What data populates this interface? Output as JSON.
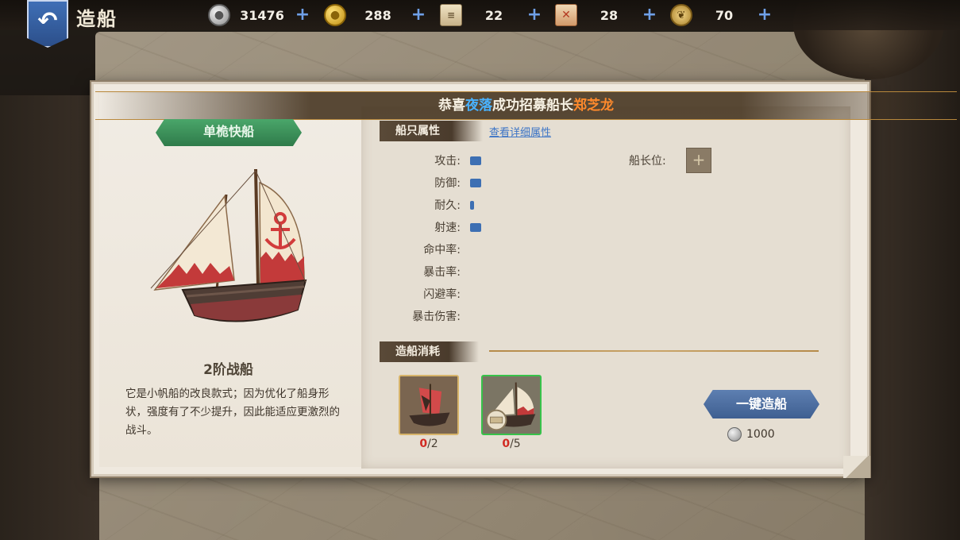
{
  "header": {
    "back_icon": "back-arrow-icon",
    "title": "造船"
  },
  "resources": [
    {
      "icon": "silver-coin-icon",
      "value": "31476",
      "color": "#cfcfcf"
    },
    {
      "icon": "gold-coin-icon",
      "value": "288",
      "color": "#e6b21c"
    },
    {
      "icon": "scroll-icon",
      "value": "22",
      "color": "#d9c59a"
    },
    {
      "icon": "map-ticket-icon",
      "value": "28",
      "color": "#d08a5a"
    },
    {
      "icon": "laurel-medal-icon",
      "value": "70",
      "color": "#c9a54e"
    }
  ],
  "banner": {
    "prefix": "恭喜",
    "player": "夜落",
    "middle": "成功招募船长",
    "captain": "郑芝龙"
  },
  "ship": {
    "type_tab": "单桅快船",
    "name": "2阶战船",
    "description": "它是小帆船的改良款式；因为优化了船身形状，强度有了不少提升，因此能适应更激烈的战斗。"
  },
  "attributes": {
    "header": "船只属性",
    "detail_link": "查看详细属性",
    "stats": [
      {
        "label": "攻击:",
        "level": 0.35
      },
      {
        "label": "防御:",
        "level": 0.35
      },
      {
        "label": "耐久:",
        "level": 0.12
      },
      {
        "label": "射速:",
        "level": 0.35
      },
      {
        "label": "命中率:",
        "level": 0
      },
      {
        "label": "暴击率:",
        "level": 0
      },
      {
        "label": "闪避率:",
        "level": 0
      },
      {
        "label": "暴击伤害:",
        "level": 0
      }
    ],
    "captain_label": "船长位:",
    "captain_slot": "+"
  },
  "cost_section": {
    "header": "造船消耗",
    "materials": [
      {
        "icon": "damaged-ship-icon",
        "have": "0",
        "need": "/2",
        "border": "#d7b46a"
      },
      {
        "icon": "sailboat-blueprint-icon",
        "have": "0",
        "need": "/5",
        "border": "#37c24a"
      }
    ],
    "build_button": "一键造船",
    "cost_value": "1000"
  }
}
